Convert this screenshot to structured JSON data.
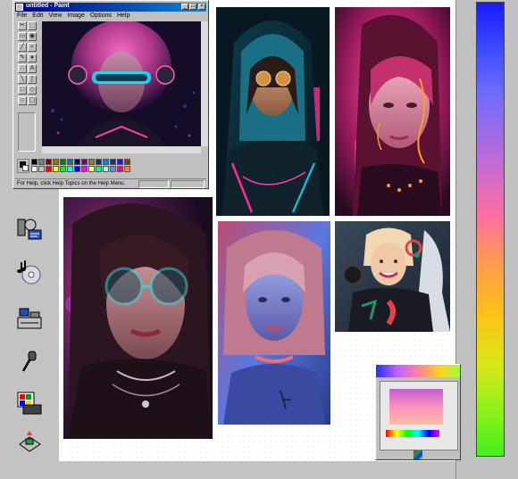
{
  "paint": {
    "title": "untitled - Paint",
    "menus": [
      "File",
      "Edit",
      "View",
      "Image",
      "Options",
      "Help"
    ],
    "status": "For Help, click Help Topics on the Help Menu.",
    "palette": [
      "#000000",
      "#808080",
      "#800000",
      "#808000",
      "#008000",
      "#008080",
      "#000080",
      "#800080",
      "#808040",
      "#004040",
      "#0080ff",
      "#004080",
      "#4000ff",
      "#804000",
      "#ffffff",
      "#c0c0c0",
      "#ff0000",
      "#ffff00",
      "#00ff00",
      "#00ffff",
      "#0000ff",
      "#ff00ff",
      "#ffff80",
      "#00ff80",
      "#80ffff",
      "#8080ff",
      "#ff0080",
      "#ff8040"
    ],
    "tools": [
      "free-select",
      "select",
      "eraser",
      "fill",
      "pick-color",
      "magnifier",
      "pencil",
      "brush",
      "airbrush",
      "text",
      "line",
      "curve",
      "rectangle",
      "polygon",
      "ellipse",
      "rounded-rectangle"
    ]
  },
  "desktop_icons": [
    "multimedia-icon",
    "cd-player-icon",
    "media-player-icon",
    "sound-recorder-icon",
    "volume-control-icon",
    "windows-setup-icon"
  ],
  "gallery": [
    {
      "name": "photo-cyberpunk-visor-girl",
      "palette": [
        "#e83fa8",
        "#16e0ff",
        "#1a1030"
      ]
    },
    {
      "name": "photo-hooded-glasses-girl",
      "palette": [
        "#1fb6c9",
        "#ff2d8f",
        "#f3a64a"
      ]
    },
    {
      "name": "photo-neon-face-lines-girl",
      "palette": [
        "#ff3b8b",
        "#ff9a30",
        "#8a1a5a"
      ]
    },
    {
      "name": "photo-round-glasses-girl",
      "palette": [
        "#3ad1d6",
        "#c93a9a",
        "#2a1730"
      ]
    },
    {
      "name": "photo-choker-girl",
      "palette": [
        "#5a78e0",
        "#ff5a5a",
        "#ff3b7a"
      ]
    },
    {
      "name": "photo-racer-girl",
      "palette": [
        "#f2d8b0",
        "#1a9a6a",
        "#e8404a"
      ]
    }
  ],
  "colors": {
    "desktop": "#c3c3c3",
    "titlebar_start": "#000080",
    "titlebar_end": "#1084d0"
  }
}
